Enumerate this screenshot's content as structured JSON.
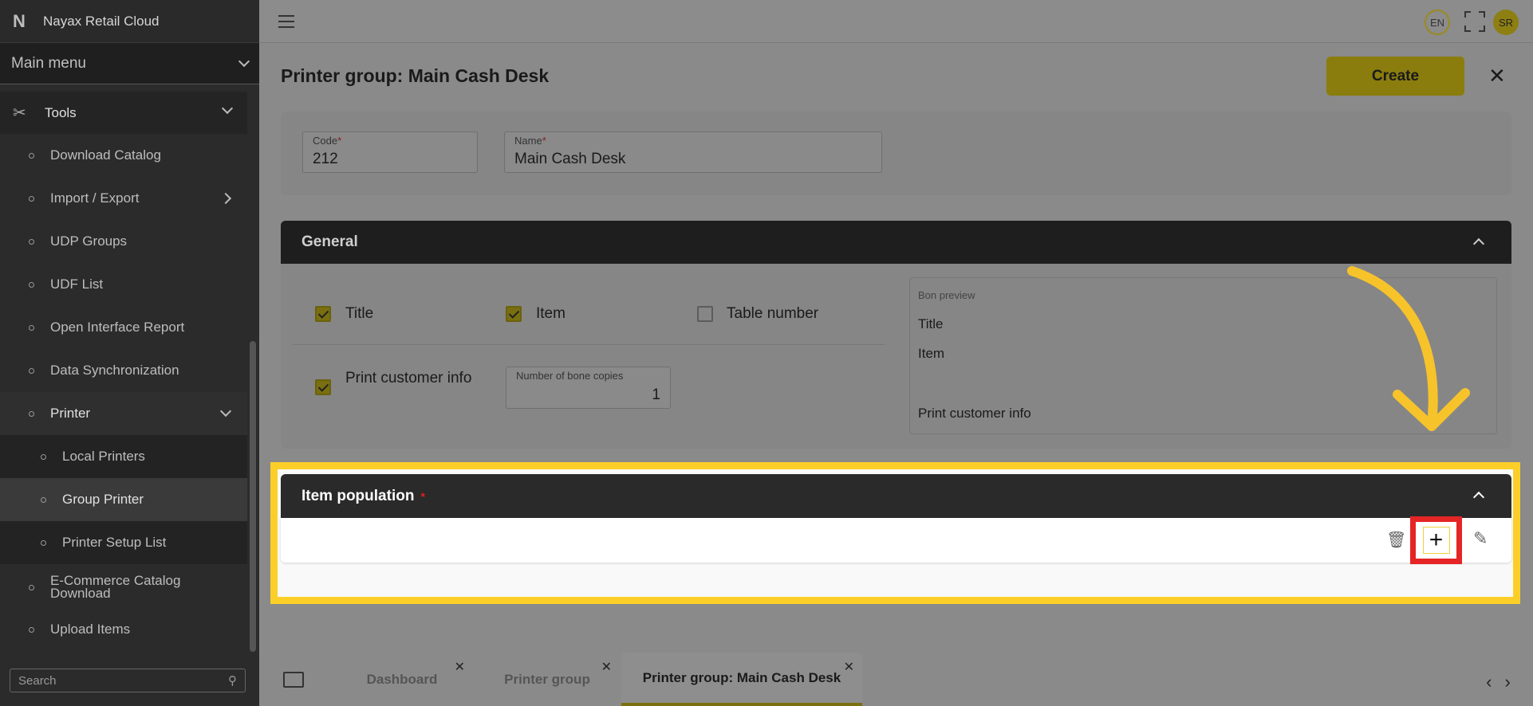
{
  "app": {
    "name": "Nayax Retail Cloud",
    "logo": "N"
  },
  "sidebar": {
    "main_menu": "Main menu",
    "tools": "Tools",
    "items": [
      {
        "label": "Download Catalog"
      },
      {
        "label": "Import / Export"
      },
      {
        "label": "UDP Groups"
      },
      {
        "label": "UDF List"
      },
      {
        "label": "Open Interface Report"
      },
      {
        "label": "Data Synchronization"
      },
      {
        "label": "Printer"
      },
      {
        "label": "Local Printers"
      },
      {
        "label": "Group Printer"
      },
      {
        "label": "Printer Setup List"
      },
      {
        "label": "E-Commerce Catalog Download"
      },
      {
        "label": "Upload Items"
      }
    ],
    "search_placeholder": "Search"
  },
  "topbar": {
    "language": "EN",
    "user_initials": "SR"
  },
  "page": {
    "title": "Printer group: Main Cash Desk",
    "create_label": "Create",
    "code_label": "Code",
    "code_value": "212",
    "name_label": "Name",
    "name_value": "Main Cash Desk",
    "required_mark": "*"
  },
  "general": {
    "title": "General",
    "title_cb": "Title",
    "item_cb": "Item",
    "table_number_cb": "Table number",
    "print_customer_cb": "Print customer info",
    "copies_label": "Number of bone copies",
    "copies_value": "1",
    "preview_label": "Bon preview",
    "preview_lines": [
      "Title",
      "Item",
      "Print customer info"
    ]
  },
  "item_population": {
    "title": "Item population",
    "required_mark": "*"
  },
  "tabs": [
    {
      "label": "Dashboard"
    },
    {
      "label": "Printer group"
    },
    {
      "label": "Printer group: Main Cash Desk"
    }
  ],
  "colors": {
    "highlight": "#fccf28",
    "add_button_box": "#e52525",
    "accent": "#d4c21a"
  }
}
